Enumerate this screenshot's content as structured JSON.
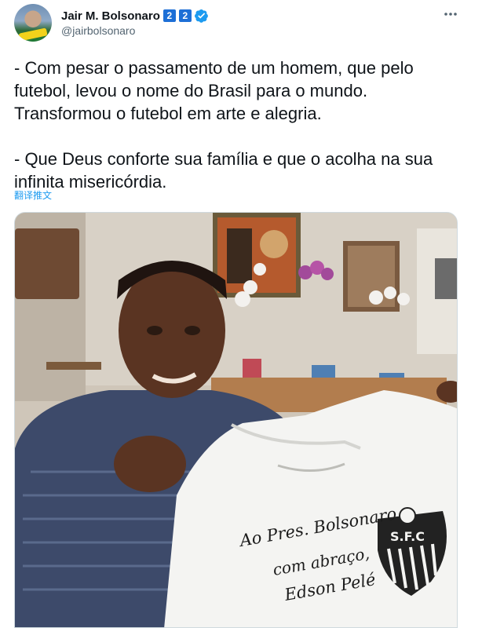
{
  "author": {
    "display_name": "Jair M. Bolsonaro",
    "badges": [
      "2",
      "2"
    ],
    "handle": "@jairbolsonaro"
  },
  "tweet": {
    "text": "- Com pesar o passamento de um homem, que pelo\nfutebol, levou o nome do Brasil para o mundo.\nTransformou o futebol em arte e alegria.\n\n- Que Deus conforte sua família e que o acolha na sua\ninfinita misericórdia.",
    "translate_label": "翻译推文"
  },
  "media": {
    "shirt_inscription": [
      "Ao Pres. Bolsonaro",
      "com abraço,",
      "Edson Pelé"
    ],
    "crest_text": "S.F.C"
  },
  "icons": {
    "verified": "verified-check-icon",
    "more": "more-options-icon"
  },
  "colors": {
    "accent": "#1d9bf0",
    "badge": "#1d6fd6",
    "muted": "#536471"
  }
}
